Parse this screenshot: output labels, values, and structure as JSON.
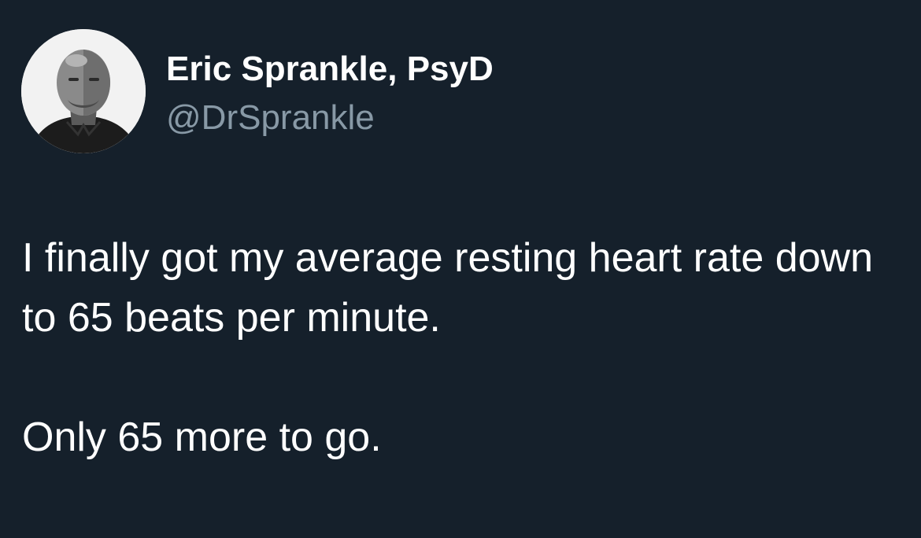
{
  "author": {
    "display_name": "Eric Sprankle, PsyD",
    "handle": "@DrSprankle"
  },
  "tweet": {
    "paragraph_1": "I finally got my average resting heart rate down to 65 beats per minute.",
    "paragraph_2": "Only 65 more to go."
  },
  "colors": {
    "background": "#15202b",
    "text": "#ffffff",
    "secondary_text": "#8899a6"
  }
}
